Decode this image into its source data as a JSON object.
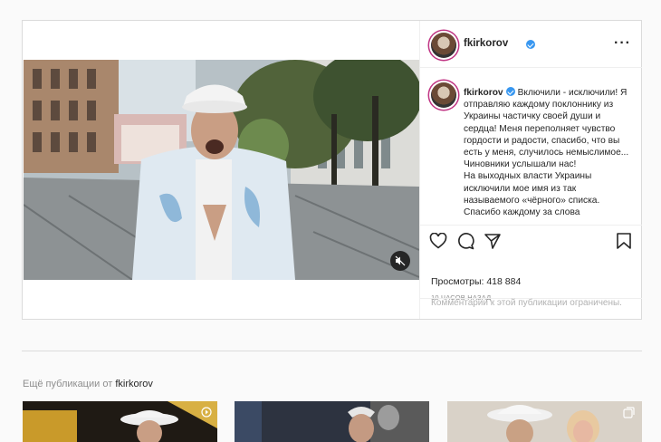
{
  "post": {
    "username": "fkirkorov",
    "caption": "Включили - исключили! Я отправляю каждому поклоннику из Украины частичку своей души и сердца! Меня переполняет чувство гордости и радости, спасибо, что вы есть у меня, случилось немыслимое... Чиновники услышали нас!\nНа выходных власти Украины исключили мое имя из так называемого «чёрного» списка. Спасибо каждому за слова",
    "views_label": "Просмотры: 418 884",
    "time": "10 ЧАСОВ НАЗАД",
    "comments_notice": "Комментарии к этой публикации ограничены."
  },
  "icons": [
    "more-icon",
    "like-icon",
    "comment-icon",
    "share-icon",
    "save-icon",
    "mute-icon",
    "verified-icon",
    "carousel-icon"
  ],
  "more_posts": {
    "prefix": "Ещё публикации от",
    "username": "fkirkorov"
  },
  "colors": {
    "verified": "#3897f0",
    "story_ring": "#c13584",
    "muted_text": "#8e8e8e",
    "border": "#dbdbdb"
  }
}
